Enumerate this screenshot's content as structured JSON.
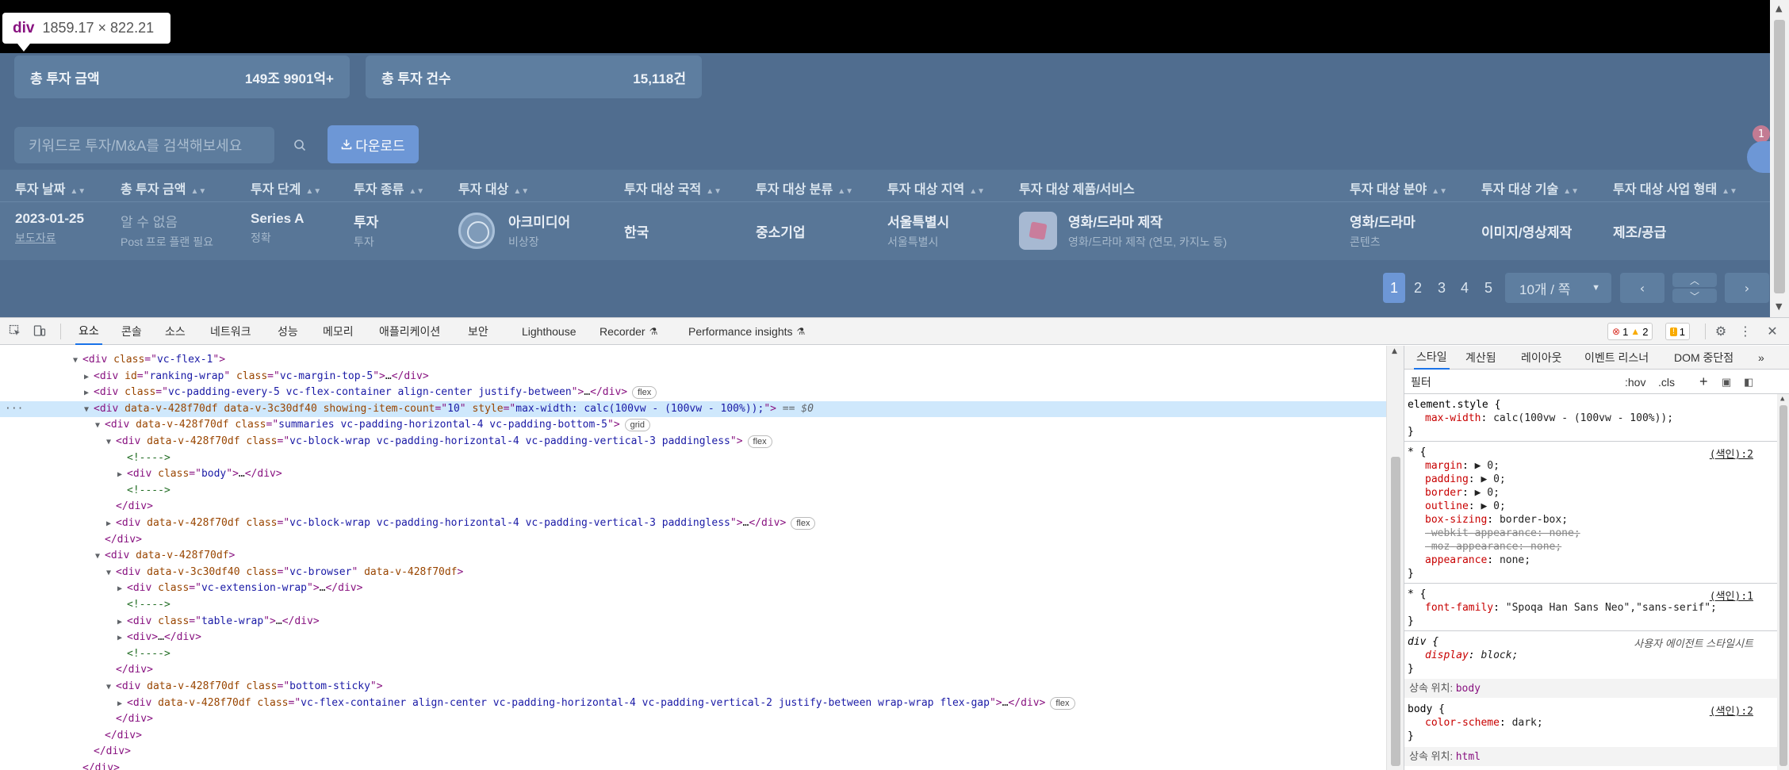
{
  "tooltip": {
    "tag": "div",
    "dimensions": "1859.17 × 822.21"
  },
  "summary": {
    "total_amount_label": "총 투자 금액",
    "total_amount_value": "149조 9901억+",
    "total_count_label": "총 투자 건수",
    "total_count_value": "15,118건"
  },
  "search": {
    "placeholder": "키워드로 투자/M&A를 검색해보세요"
  },
  "download": {
    "label": "다운로드"
  },
  "table": {
    "headers": [
      "투자 날짜",
      "총 투자 금액",
      "투자 단계",
      "투자 종류",
      "투자 대상",
      "투자 대상 국적",
      "투자 대상 분류",
      "투자 대상 지역",
      "투자 대상 제품/서비스",
      "투자 대상 분야",
      "투자 대상 기술",
      "투자 대상 사업 형태"
    ],
    "row": {
      "date": "2023-01-25",
      "date_sub": "보도자료",
      "amount": "알 수 없음",
      "amount_sub": "Post 프로 플랜 필요",
      "stage": "Series A",
      "stage_sub": "정확",
      "type": "투자",
      "type_sub": "투자",
      "target": "아크미디어",
      "target_sub": "비상장",
      "nationality": "한국",
      "category": "중소기업",
      "region": "서울특별시",
      "region_sub": "서울특별시",
      "product": "영화/드라마 제작",
      "product_sub": "영화/드라마 제작 (연모, 카지노 등)",
      "field": "영화/드라마",
      "field_sub": "콘텐츠",
      "tech": "이미지/영상제작",
      "business": "제조/공급"
    }
  },
  "pagination": {
    "pages": [
      "1",
      "2",
      "3",
      "4",
      "5"
    ],
    "active": "1",
    "per_page": "10개 / 쪽"
  },
  "side": {
    "badge": "1"
  },
  "devtools": {
    "tabs": [
      "요소",
      "콘솔",
      "소스",
      "네트워크",
      "성능",
      "메모리",
      "애플리케이션",
      "보안",
      "Lighthouse",
      "Recorder",
      "Performance insights"
    ],
    "errors": "1",
    "warnings": "2",
    "issues": "1",
    "dom": [
      {
        "indent": 0,
        "tri": "▼",
        "html": [
          [
            "tg",
            "<div "
          ],
          [
            "an",
            "class"
          ],
          [
            "tg",
            "=\""
          ],
          [
            "av",
            "vc-flex-1"
          ],
          [
            "tg",
            "\">"
          ]
        ]
      },
      {
        "indent": 1,
        "tri": "▶",
        "html": [
          [
            "tg",
            "<div "
          ],
          [
            "an",
            "id"
          ],
          [
            "tg",
            "=\""
          ],
          [
            "av",
            "ranking-wrap"
          ],
          [
            "tg",
            "\" "
          ],
          [
            "an",
            "class"
          ],
          [
            "tg",
            "=\""
          ],
          [
            "av",
            "vc-margin-top-5"
          ],
          [
            "tg",
            "\">"
          ],
          [
            "tx",
            "…"
          ],
          [
            "tg",
            "</div>"
          ]
        ]
      },
      {
        "indent": 1,
        "tri": "▶",
        "html": [
          [
            "tg",
            "<div "
          ],
          [
            "an",
            "class"
          ],
          [
            "tg",
            "=\""
          ],
          [
            "av",
            "vc-padding-every-5 vc-flex-container align-center justify-between"
          ],
          [
            "tg",
            "\">"
          ],
          [
            "tx",
            "…"
          ],
          [
            "tg",
            "</div>"
          ]
        ],
        "pill": "flex"
      },
      {
        "indent": 1,
        "tri": "▼",
        "sel": true,
        "html": [
          [
            "tg",
            "<div "
          ],
          [
            "an",
            "data-v-428f70df data-v-3c30df40 showing-item-count"
          ],
          [
            "tg",
            "=\""
          ],
          [
            "av",
            "10"
          ],
          [
            "tg",
            "\" "
          ],
          [
            "an",
            "style"
          ],
          [
            "tg",
            "=\""
          ],
          [
            "av",
            "max-width: calc(100vw - (100vw - 100%));"
          ],
          [
            "tg",
            "\">"
          ],
          [
            "tx",
            " == $0"
          ]
        ]
      },
      {
        "indent": 2,
        "tri": "▼",
        "html": [
          [
            "tg",
            "<div "
          ],
          [
            "an",
            "data-v-428f70df class"
          ],
          [
            "tg",
            "=\""
          ],
          [
            "av",
            "summaries vc-padding-horizontal-4 vc-padding-bottom-5"
          ],
          [
            "tg",
            "\">"
          ]
        ],
        "pill": "grid"
      },
      {
        "indent": 3,
        "tri": "▼",
        "html": [
          [
            "tg",
            "<div "
          ],
          [
            "an",
            "data-v-428f70df class"
          ],
          [
            "tg",
            "=\""
          ],
          [
            "av",
            "vc-block-wrap vc-padding-horizontal-4 vc-padding-vertical-3 paddingless"
          ],
          [
            "tg",
            "\">"
          ]
        ],
        "pill": "flex"
      },
      {
        "indent": 4,
        "tri": "",
        "html": [
          [
            "cm",
            "<!---->"
          ]
        ]
      },
      {
        "indent": 4,
        "tri": "▶",
        "html": [
          [
            "tg",
            "<div "
          ],
          [
            "an",
            "class"
          ],
          [
            "tg",
            "=\""
          ],
          [
            "av",
            "body"
          ],
          [
            "tg",
            "\">"
          ],
          [
            "tx",
            "…"
          ],
          [
            "tg",
            "</div>"
          ]
        ]
      },
      {
        "indent": 4,
        "tri": "",
        "html": [
          [
            "cm",
            "<!---->"
          ]
        ]
      },
      {
        "indent": 3,
        "tri": "",
        "html": [
          [
            "tg",
            "</div>"
          ]
        ]
      },
      {
        "indent": 3,
        "tri": "▶",
        "html": [
          [
            "tg",
            "<div "
          ],
          [
            "an",
            "data-v-428f70df class"
          ],
          [
            "tg",
            "=\""
          ],
          [
            "av",
            "vc-block-wrap vc-padding-horizontal-4 vc-padding-vertical-3 paddingless"
          ],
          [
            "tg",
            "\">"
          ],
          [
            "tx",
            "…"
          ],
          [
            "tg",
            "</div>"
          ]
        ],
        "pill": "flex"
      },
      {
        "indent": 2,
        "tri": "",
        "html": [
          [
            "tg",
            "</div>"
          ]
        ]
      },
      {
        "indent": 2,
        "tri": "▼",
        "html": [
          [
            "tg",
            "<div "
          ],
          [
            "an",
            "data-v-428f70df"
          ],
          [
            "tg",
            ">"
          ]
        ]
      },
      {
        "indent": 3,
        "tri": "▼",
        "html": [
          [
            "tg",
            "<div "
          ],
          [
            "an",
            "data-v-3c30df40 class"
          ],
          [
            "tg",
            "=\""
          ],
          [
            "av",
            "vc-browser"
          ],
          [
            "tg",
            "\" "
          ],
          [
            "an",
            "data-v-428f70df"
          ],
          [
            "tg",
            ">"
          ]
        ]
      },
      {
        "indent": 4,
        "tri": "▶",
        "html": [
          [
            "tg",
            "<div "
          ],
          [
            "an",
            "class"
          ],
          [
            "tg",
            "=\""
          ],
          [
            "av",
            "vc-extension-wrap"
          ],
          [
            "tg",
            "\">"
          ],
          [
            "tx",
            "…"
          ],
          [
            "tg",
            "</div>"
          ]
        ]
      },
      {
        "indent": 4,
        "tri": "",
        "html": [
          [
            "cm",
            "<!---->"
          ]
        ]
      },
      {
        "indent": 4,
        "tri": "▶",
        "html": [
          [
            "tg",
            "<div "
          ],
          [
            "an",
            "class"
          ],
          [
            "tg",
            "=\""
          ],
          [
            "av",
            "table-wrap"
          ],
          [
            "tg",
            "\">"
          ],
          [
            "tx",
            "…"
          ],
          [
            "tg",
            "</div>"
          ]
        ]
      },
      {
        "indent": 4,
        "tri": "▶",
        "html": [
          [
            "tg",
            "<div>"
          ],
          [
            "tx",
            "…"
          ],
          [
            "tg",
            "</div>"
          ]
        ]
      },
      {
        "indent": 4,
        "tri": "",
        "html": [
          [
            "cm",
            "<!---->"
          ]
        ]
      },
      {
        "indent": 3,
        "tri": "",
        "html": [
          [
            "tg",
            "</div>"
          ]
        ]
      },
      {
        "indent": 3,
        "tri": "▼",
        "html": [
          [
            "tg",
            "<div "
          ],
          [
            "an",
            "data-v-428f70df class"
          ],
          [
            "tg",
            "=\""
          ],
          [
            "av",
            "bottom-sticky"
          ],
          [
            "tg",
            "\">"
          ]
        ]
      },
      {
        "indent": 4,
        "tri": "▶",
        "html": [
          [
            "tg",
            "<div "
          ],
          [
            "an",
            "data-v-428f70df class"
          ],
          [
            "tg",
            "=\""
          ],
          [
            "av",
            "vc-flex-container align-center vc-padding-horizontal-4 vc-padding-vertical-2 justify-between wrap-wrap flex-gap"
          ],
          [
            "tg",
            "\">"
          ],
          [
            "tx",
            "…"
          ],
          [
            "tg",
            "</div>"
          ]
        ],
        "pill": "flex"
      },
      {
        "indent": 3,
        "tri": "",
        "html": [
          [
            "tg",
            "</div>"
          ]
        ]
      },
      {
        "indent": 2,
        "tri": "",
        "html": [
          [
            "tg",
            "</div>"
          ]
        ]
      },
      {
        "indent": 1,
        "tri": "",
        "html": [
          [
            "tg",
            "</div>"
          ]
        ]
      },
      {
        "indent": 0,
        "tri": "",
        "html": [
          [
            "tg",
            "</div>"
          ]
        ]
      }
    ],
    "styles_tabs": [
      "스타일",
      "계산됨",
      "레이아웃",
      "이벤트 리스너",
      "DOM 중단점"
    ],
    "filter_placeholder": "필터",
    "hov": ":hov",
    "cls": ".cls",
    "styles": {
      "element_style": "element.style {",
      "max_width": "max-width",
      "max_width_val": "calc(100vw - (100vw - 100%));",
      "star": "* {",
      "src1": "(색인):2",
      "margin": "margin",
      "margin_val": "▶ 0;",
      "padding": "padding",
      "padding_val": "▶ 0;",
      "border": "border",
      "border_val": "▶ 0;",
      "outline": "outline",
      "outline_val": "▶ 0;",
      "box_sizing": "box-sizing",
      "box_sizing_val": "border-box;",
      "webkit_app": "-webkit-appearance: none;",
      "moz_app": "-moz-appearance: none;",
      "appearance": "appearance",
      "appearance_val": "none;",
      "src2": "(색인):1",
      "font_family": "font-family",
      "font_family_val": "\"Spoqa Han Sans Neo\",\"sans-serif\";",
      "div_sel": "div {",
      "ua": "사용자 에이전트 스타일시트",
      "display": "display",
      "display_val": "block;",
      "inherited": "상속 위치:",
      "body": "body",
      "body_sel": "body {",
      "src3": "(색인):2",
      "color_scheme": "color-scheme",
      "color_scheme_val": "dark;",
      "html": "html",
      "close": "}"
    }
  }
}
